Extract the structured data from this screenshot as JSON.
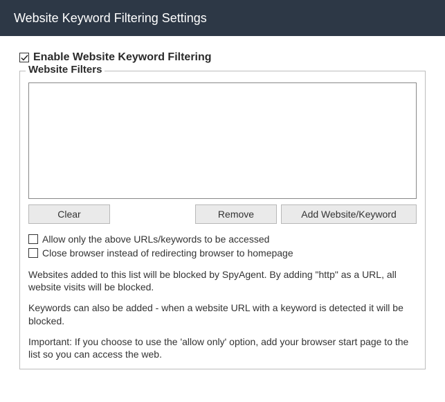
{
  "titlebar": {
    "title": "Website Keyword Filtering Settings"
  },
  "enable": {
    "checked": true,
    "label": "Enable Website Keyword Filtering"
  },
  "filters": {
    "legend": "Website Filters",
    "items": [],
    "buttons": {
      "clear": "Clear",
      "remove": "Remove",
      "add": "Add Website/Keyword"
    },
    "options": {
      "allow_only": {
        "checked": false,
        "label": "Allow only the above URLs/keywords to be accessed"
      },
      "close_browser": {
        "checked": false,
        "label": "Close browser instead of redirecting browser to homepage"
      }
    },
    "help1": "Websites added to this list will be blocked by SpyAgent. By adding \"http\" as a URL, all website visits will be blocked.",
    "help2": "Keywords can also be added - when a website URL with a keyword is detected it will be blocked.",
    "help3": "Important: If you choose to use the 'allow only' option, add your browser start page to the list so you can access the web."
  }
}
